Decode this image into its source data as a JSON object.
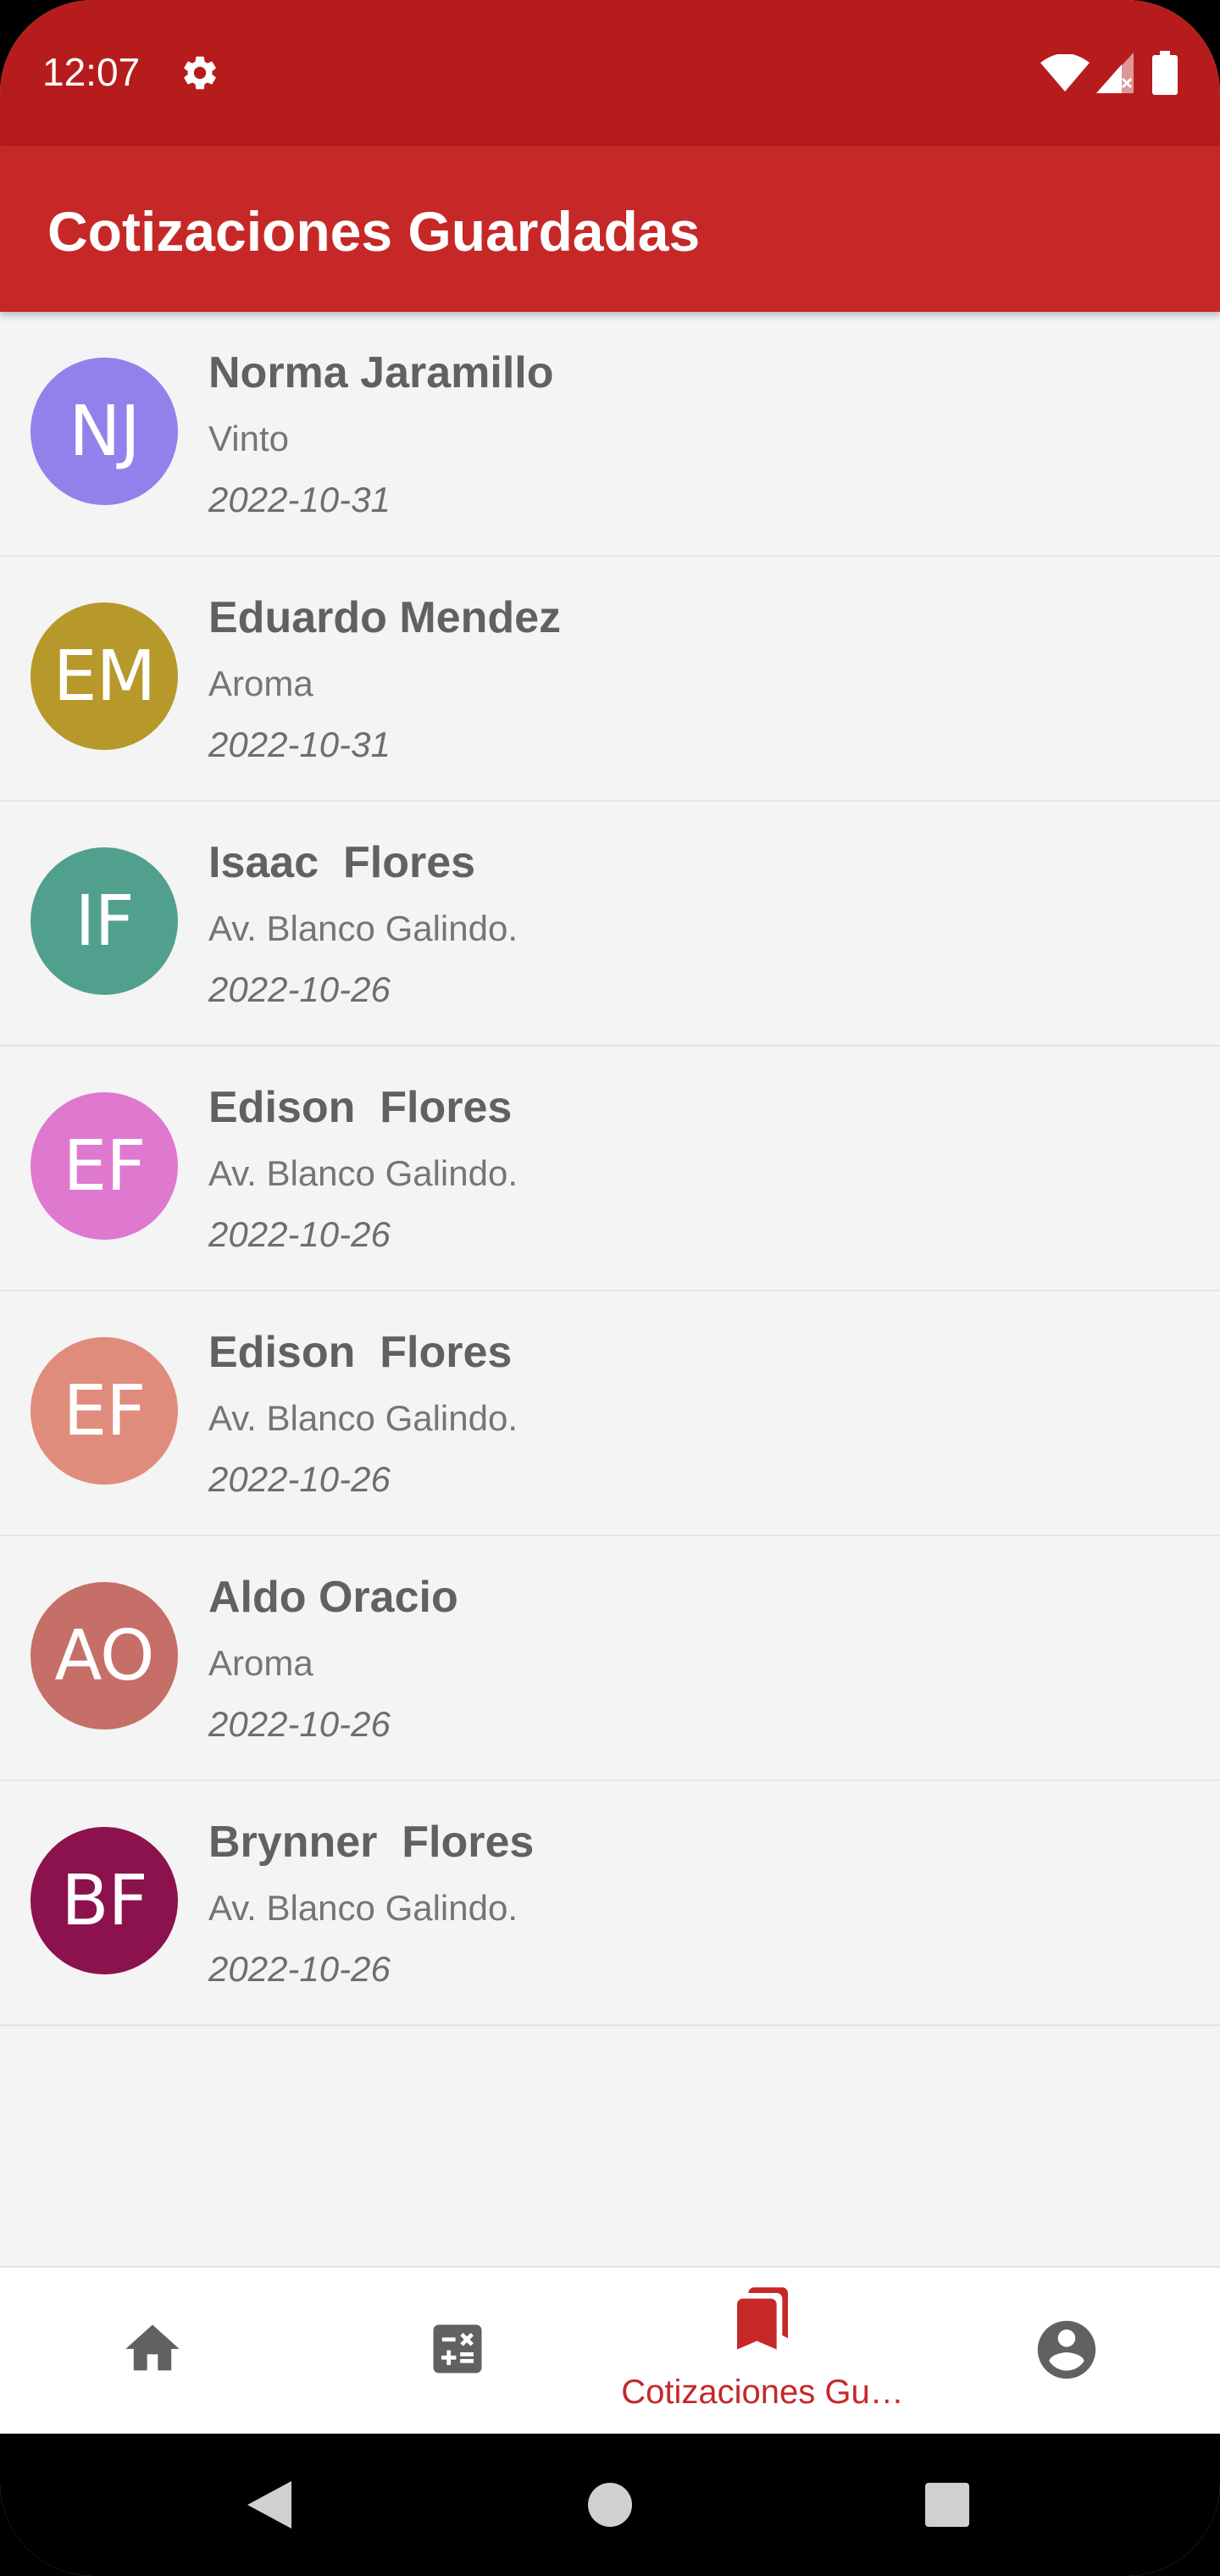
{
  "status_bar": {
    "time": "12:07",
    "icons": [
      "gear-icon",
      "wifi-icon",
      "signal-icon",
      "battery-icon"
    ]
  },
  "app_bar": {
    "title": "Cotizaciones Guardadas"
  },
  "quotes": [
    {
      "initials": "NJ",
      "name": "Norma Jaramillo",
      "place": "Vinto",
      "date": "2022-10-31",
      "color": "#9181ea"
    },
    {
      "initials": "EM",
      "name": "Eduardo Mendez",
      "place": "Aroma",
      "date": "2022-10-31",
      "color": "#b7982a"
    },
    {
      "initials": "IF",
      "name": "Isaac  Flores",
      "place": "Av. Blanco Galindo.",
      "date": "2022-10-26",
      "color": "#51a08e"
    },
    {
      "initials": "EF",
      "name": "Edison  Flores",
      "place": "Av. Blanco Galindo.",
      "date": "2022-10-26",
      "color": "#de79cf"
    },
    {
      "initials": "EF",
      "name": "Edison  Flores",
      "place": "Av. Blanco Galindo.",
      "date": "2022-10-26",
      "color": "#e08c7c"
    },
    {
      "initials": "AO",
      "name": "Aldo Oracio",
      "place": "Aroma",
      "date": "2022-10-26",
      "color": "#c66e68"
    },
    {
      "initials": "BF",
      "name": "Brynner  Flores",
      "place": "Av. Blanco Galindo.",
      "date": "2022-10-26",
      "color": "#8b124c"
    }
  ],
  "bottom_nav": {
    "items": [
      {
        "icon": "home-icon",
        "label": ""
      },
      {
        "icon": "calculator-icon",
        "label": ""
      },
      {
        "icon": "bookmarks-icon",
        "label": "Cotizaciones Gu…",
        "active": true
      },
      {
        "icon": "account-icon",
        "label": ""
      }
    ],
    "active_color": "#c62828",
    "inactive_color": "#616161"
  },
  "system_nav": {
    "icons": [
      "back-icon",
      "home-circle-icon",
      "recents-icon"
    ]
  }
}
